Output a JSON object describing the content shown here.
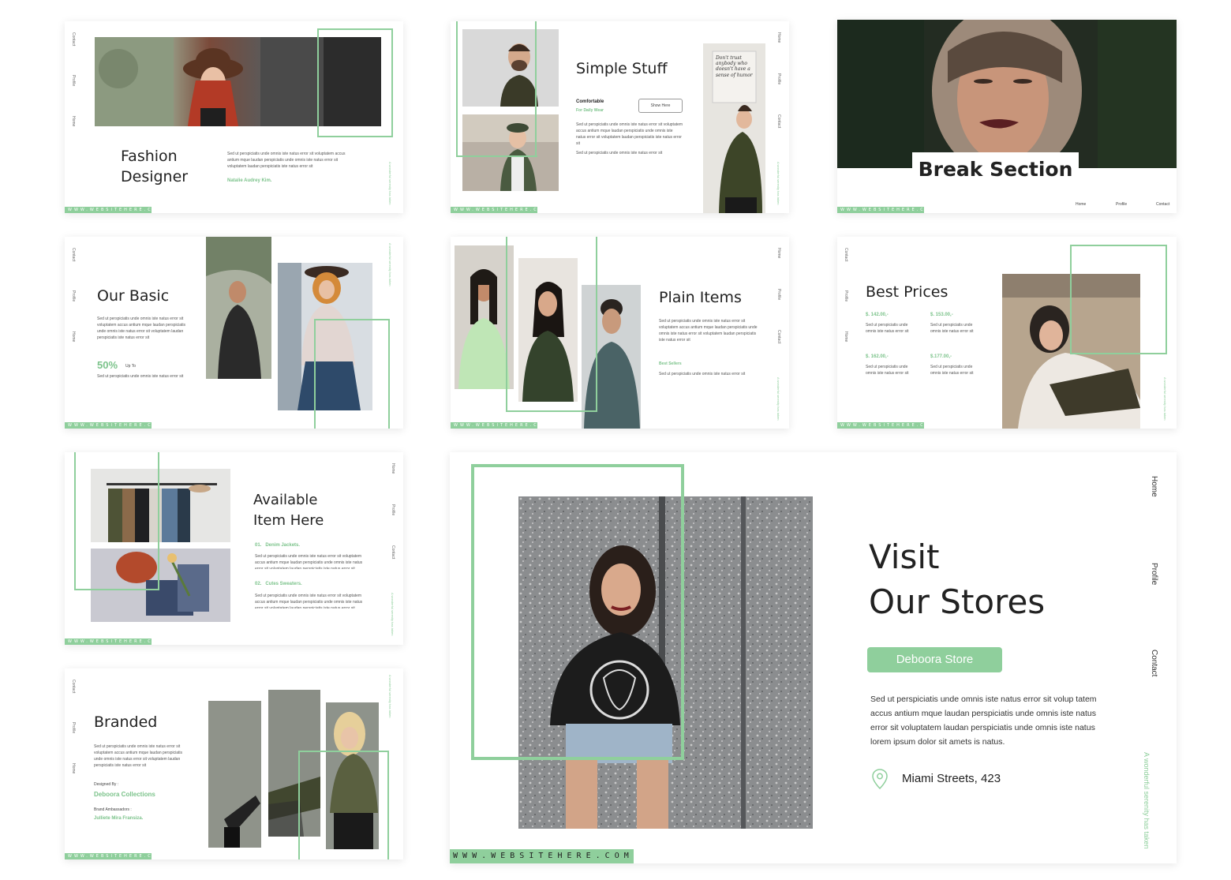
{
  "website": "W W W . W E B S I T E H E R E . C O M",
  "website_small": "WWW.WEBSITEHERE.COM",
  "nav": {
    "home": "Home",
    "profile": "Profile",
    "contact": "Contact"
  },
  "tagline": "A wonderful serenity has taken",
  "lorem_short": "Sed ut perspiciatis unde omnis iste natus error sit voluptatem accus antium mque laudan perspiciatis unde omnis iste natus error sit voluptatem laudan perspiciatis iste natus error sit",
  "lorem_tiny": "Sed ut perspiciatis unde omnis iste natus error sit",
  "s1": {
    "title1": "Fashion",
    "title2": "Designer",
    "author": "Natalie Audrey Kim."
  },
  "s2": {
    "title": "Simple Stuff",
    "sub": "Comfortable",
    "sub2": "For Daily Wear",
    "button": "Show Here",
    "sign": "Don't trust anybody who doesn't have a sense of humor"
  },
  "s3": {
    "title": "Break Section"
  },
  "s4": {
    "title": "Our Basic",
    "percent": "50%",
    "upto": "Up To"
  },
  "s5": {
    "title": "Plain Items",
    "best": "Best Sellers"
  },
  "s6": {
    "title": "Best Prices",
    "prices": [
      "$. 142.00,-",
      "$. 153.00,-",
      "$. 162.00,-",
      "$.177.00,-"
    ]
  },
  "s7": {
    "title1": "Available",
    "title2": "Item Here",
    "item1": "01.   Denim Jackets.",
    "item2": "02.   Cutes Sweaters."
  },
  "s8": {
    "title": "Branded",
    "designed_by": "Designed By :",
    "designer": "Deboora Collections",
    "ambassador": "Brand Ambassadors :",
    "ambassador_name": "Julliete Mira Fransiza."
  },
  "big": {
    "title1": "Visit",
    "title2": "Our Stores",
    "button": "Deboora Store",
    "body": "Sed ut perspiciatis unde omnis iste natus error sit volup tatem accus antium mque laudan perspiciatis unde omnis iste natus error sit voluptatem laudan perspiciatis unde omnis iste natus lorem ipsum dolor sit amets is natus.",
    "address": "Miami Streets, 423",
    "tagline": "A wonderful serenity has taken"
  },
  "colors": {
    "accent": "#8fcf9c",
    "accent_text": "#7cc38b"
  }
}
